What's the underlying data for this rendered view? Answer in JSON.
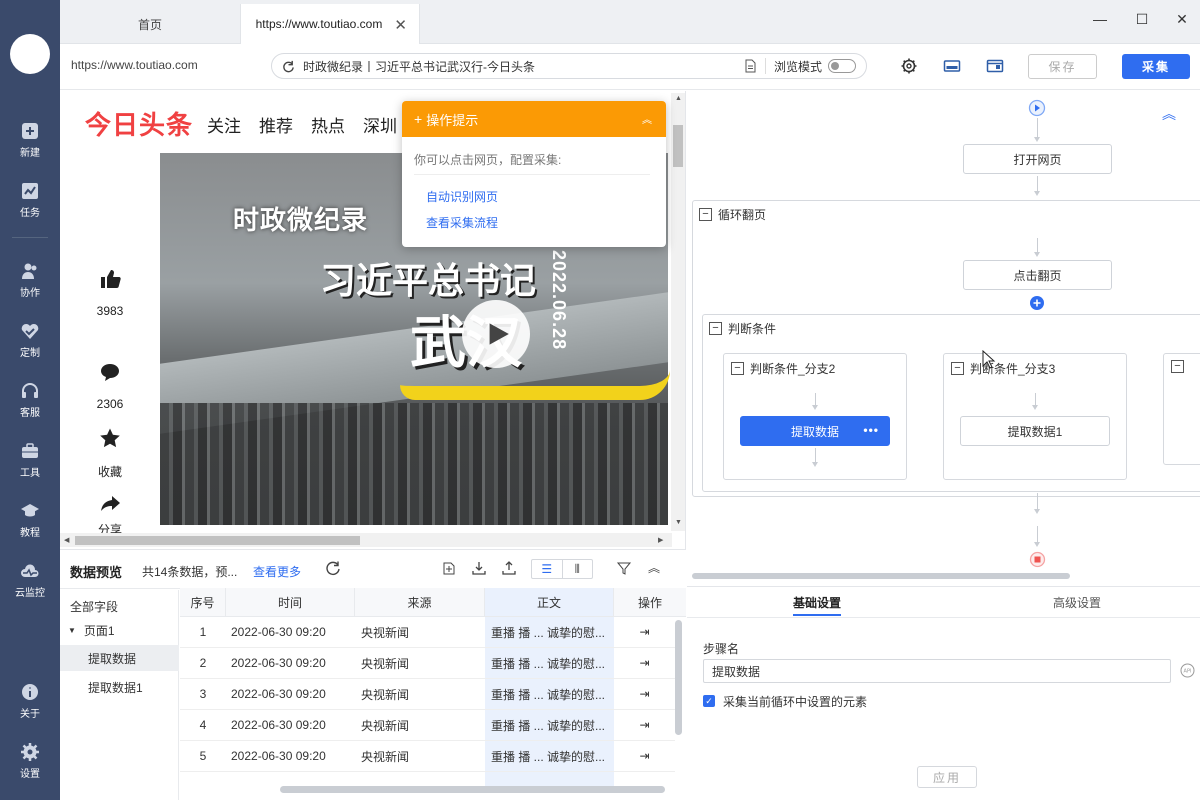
{
  "rail": {
    "items": [
      {
        "label": "新建",
        "icon": "plus-square-icon"
      },
      {
        "label": "任务",
        "icon": "task-chart-icon"
      },
      {
        "label": "协作",
        "icon": "people-icon"
      },
      {
        "label": "定制",
        "icon": "check-heart-icon"
      },
      {
        "label": "客服",
        "icon": "headset-icon"
      },
      {
        "label": "工具",
        "icon": "toolbox-icon"
      },
      {
        "label": "教程",
        "icon": "graduation-cap-icon"
      },
      {
        "label": "云监控",
        "icon": "cloud-pulse-icon"
      },
      {
        "label": "关于",
        "icon": "info-icon"
      },
      {
        "label": "设置",
        "icon": "gear-icon"
      }
    ]
  },
  "tabs": {
    "home": "首页",
    "active": "https://www.toutiao.com",
    "close": "✕"
  },
  "window": {
    "minimize": "—",
    "maximize": "☐",
    "close": "✕"
  },
  "address": {
    "url_left": "https://www.toutiao.com",
    "page_title": "时政微纪录丨习近平总书记武汉行-今日头条",
    "browse_mode": "浏览模式"
  },
  "toolbar": {
    "save": "保存",
    "collect": "采集"
  },
  "page": {
    "brand": "今日头条",
    "nav": [
      "关注",
      "推荐",
      "热点",
      "深圳"
    ],
    "video": {
      "line1": "时政微纪录",
      "line2": "习近平总书记",
      "line3": "武汉",
      "date": "2022.06.28"
    },
    "actions": [
      {
        "count": "3983",
        "icon": "thumbs-up-icon"
      },
      {
        "count": "2306",
        "icon": "comment-icon"
      },
      {
        "count": "收藏",
        "icon": "star-icon"
      },
      {
        "count": "分享",
        "icon": "share-icon"
      }
    ]
  },
  "tip": {
    "title": "操作提示",
    "desc": "你可以点击网页，配置采集:",
    "link1": "自动识别网页",
    "link2": "查看采集流程"
  },
  "preview": {
    "title": "数据预览",
    "summary": "共14条数据，预...",
    "more": "查看更多",
    "tree": {
      "all": "全部字段",
      "page": "页面1",
      "item1": "提取数据",
      "item2": "提取数据1"
    },
    "columns": [
      "序号",
      "时间",
      "来源",
      "正文",
      "操作"
    ],
    "rows": [
      {
        "no": "1",
        "time": "2022-06-30 09:20",
        "source": "央视新闻",
        "body": "重播 播 ... 诚挚的慰..."
      },
      {
        "no": "2",
        "time": "2022-06-30 09:20",
        "source": "央视新闻",
        "body": "重播 播 ... 诚挚的慰..."
      },
      {
        "no": "3",
        "time": "2022-06-30 09:20",
        "source": "央视新闻",
        "body": "重播 播 ... 诚挚的慰..."
      },
      {
        "no": "4",
        "time": "2022-06-30 09:20",
        "source": "央视新闻",
        "body": "重播 播 ... 诚挚的慰..."
      },
      {
        "no": "5",
        "time": "2022-06-30 09:20",
        "source": "央视新闻",
        "body": "重播 播 ... 诚挚的慰..."
      }
    ]
  },
  "flow": {
    "open_page": "打开网页",
    "loop": "循环翻页",
    "click_next": "点击翻页",
    "condition": "判断条件",
    "branch2": "判断条件_分支2",
    "branch3": "判断条件_分支3",
    "extract": "提取数据",
    "extract1": "提取数据1"
  },
  "settings": {
    "tab_basic": "基础设置",
    "tab_advanced": "高级设置",
    "step_name_label": "步骤名",
    "step_name_value": "提取数据",
    "checkbox_label": "采集当前循环中设置的元素",
    "apply": "应用"
  },
  "colors": {
    "accent": "#2f6df0",
    "rail": "#3a4a6b",
    "tip": "#fb9a05",
    "brand": "#f04142"
  }
}
